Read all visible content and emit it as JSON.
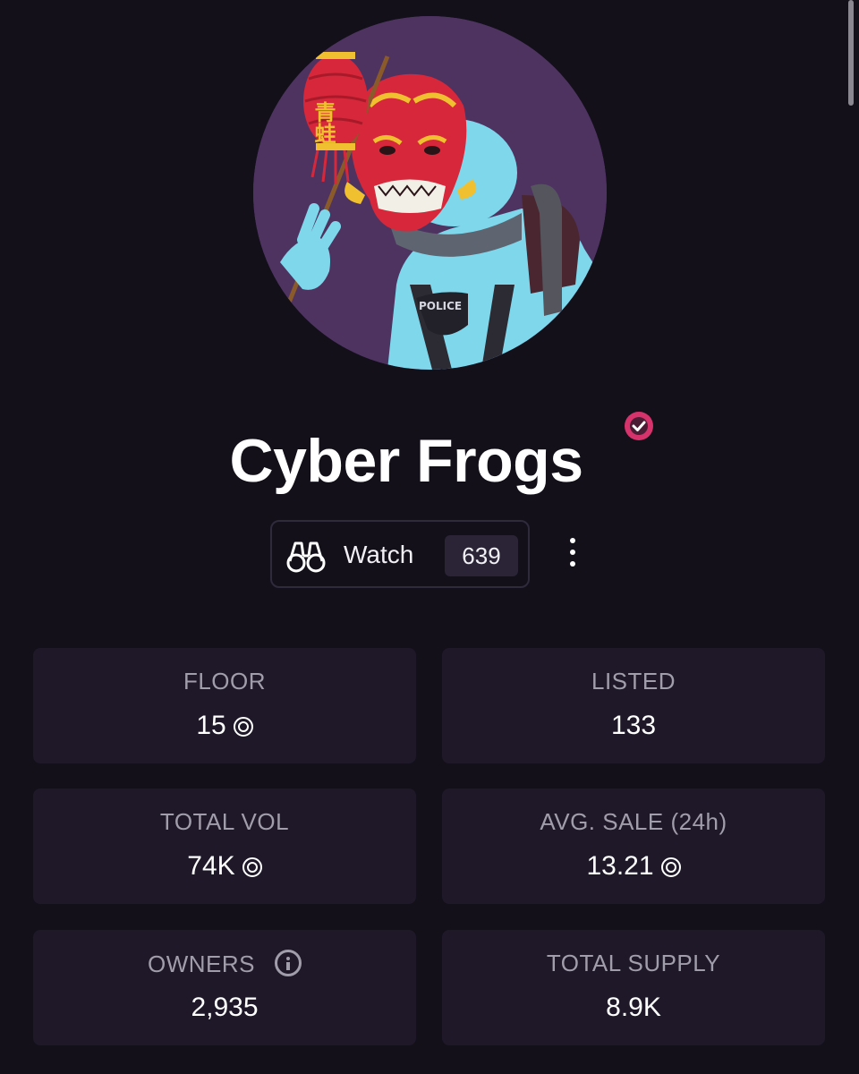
{
  "collection": {
    "name": "Cyber Frogs",
    "verified": true,
    "verified_color": "#d6336c",
    "avatar_lantern_text": "青蛙",
    "avatar_badge_text": "POLICE"
  },
  "watch": {
    "label": "Watch",
    "count": "639"
  },
  "stats": {
    "floor": {
      "label": "FLOOR",
      "value": "15",
      "unit_icon": "sol-coin-icon"
    },
    "listed": {
      "label": "LISTED",
      "value": "133"
    },
    "total_vol": {
      "label": "TOTAL VOL",
      "value": "74K",
      "unit_icon": "sol-coin-icon"
    },
    "avg_sale": {
      "label": "AVG. SALE (24h)",
      "value": "13.21",
      "unit_icon": "sol-coin-icon"
    },
    "owners": {
      "label": "OWNERS",
      "value": "2,935",
      "info_icon": "info-icon"
    },
    "total_supply": {
      "label": "TOTAL SUPPLY",
      "value": "8.9K"
    }
  },
  "colors": {
    "background": "#13101a",
    "card": "#1e1829",
    "label": "#a29daa",
    "avatar_bg": "#4e3361"
  }
}
